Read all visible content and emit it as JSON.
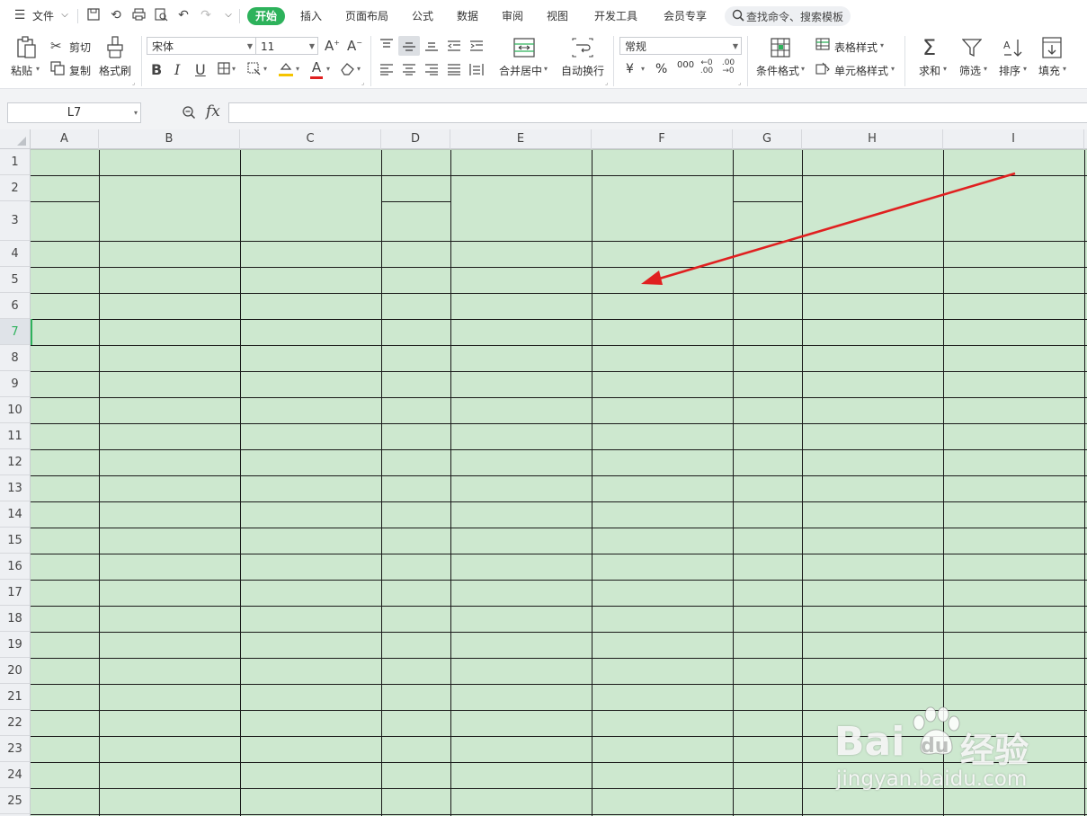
{
  "menubar": {
    "file_label": "文件",
    "tabs": [
      "开始",
      "插入",
      "页面布局",
      "公式",
      "数据",
      "审阅",
      "视图",
      "开发工具",
      "会员专享"
    ],
    "active_tab": "开始",
    "search_placeholder": "查找命令、搜索模板"
  },
  "ribbon": {
    "paste": "粘贴",
    "cut": "剪切",
    "copy": "复制",
    "format_painter": "格式刷",
    "font_name": "宋体",
    "font_size": "11",
    "merge_center": "合并居中",
    "wrap_text": "自动换行",
    "number_format": "常规",
    "currency_symbol": "¥",
    "percent_symbol": "%",
    "thousands_symbol": "000",
    "conditional_format": "条件格式",
    "table_style": "表格样式",
    "cell_style": "单元格样式",
    "sum": "求和",
    "filter": "筛选",
    "sort": "排序",
    "fill": "填充"
  },
  "formula_bar": {
    "name_box": "L7",
    "fx_label": "fx",
    "formula": ""
  },
  "sheet": {
    "columns": [
      "A",
      "B",
      "C",
      "D",
      "E",
      "F",
      "G",
      "H",
      "I"
    ],
    "rows": [
      "1",
      "2",
      "3",
      "4",
      "5",
      "6",
      "7",
      "8",
      "9",
      "10",
      "11",
      "12",
      "13",
      "14",
      "15",
      "16",
      "17",
      "18",
      "19",
      "20",
      "21",
      "22",
      "23",
      "24",
      "25"
    ],
    "selected_row": "7",
    "cell_fill_color": "#cde8cf",
    "border_color": "#1a1a1a"
  },
  "annotation": {
    "arrow_color": "#e02020"
  },
  "watermark": {
    "brand": "Bai",
    "brand2": "du",
    "product": "经验",
    "url": "jingyan.baidu.com"
  },
  "colors": {
    "accent": "#2db25b"
  }
}
